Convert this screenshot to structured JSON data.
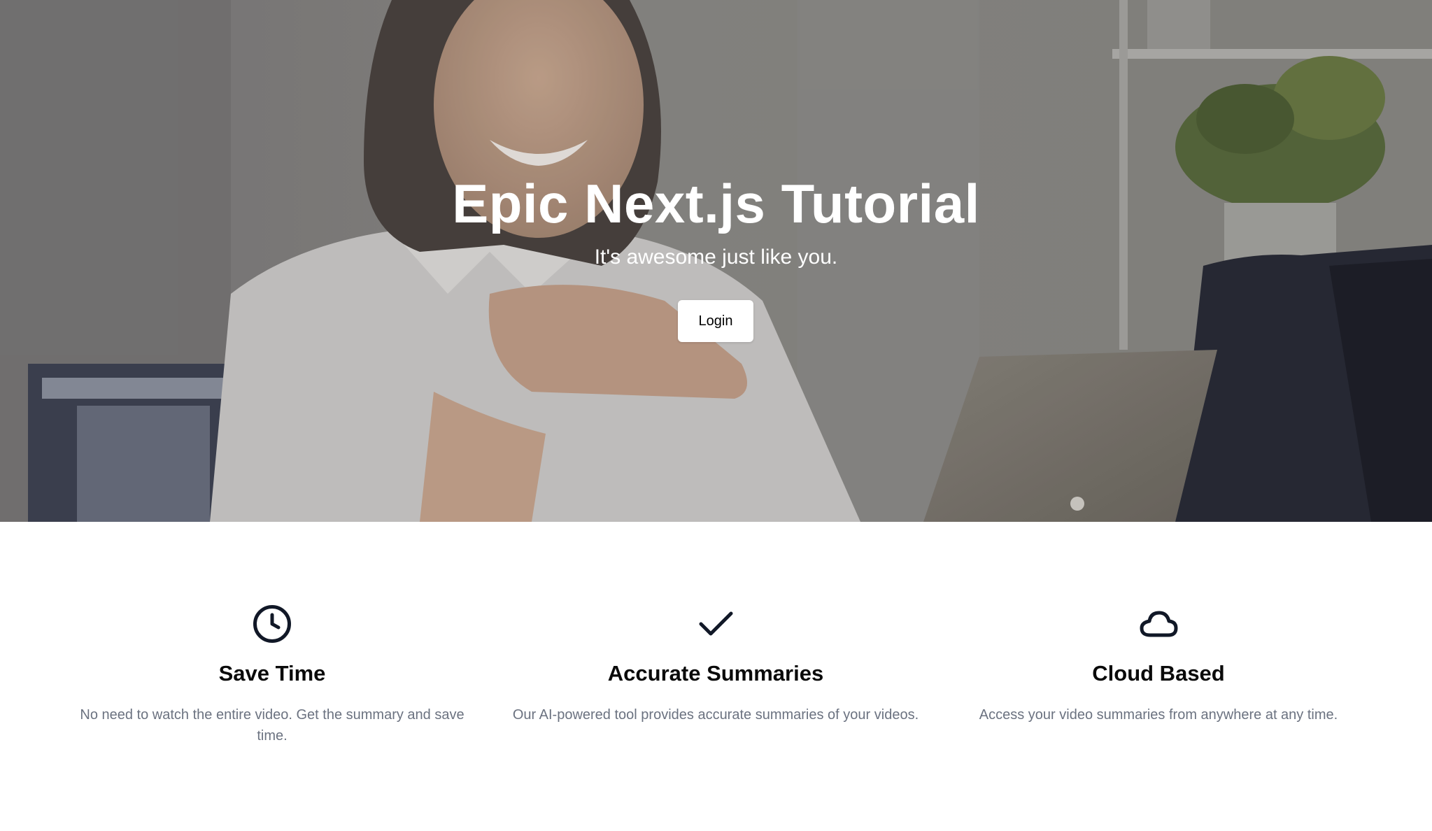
{
  "hero": {
    "title": "Epic Next.js Tutorial",
    "subtitle": "It's awesome just like you.",
    "login_label": "Login",
    "image_alt": "Smiling woman sitting at a desk with a laptop"
  },
  "features": [
    {
      "icon": "clock-icon",
      "title": "Save Time",
      "text": "No need to watch the entire video. Get the summary and save time."
    },
    {
      "icon": "check-icon",
      "title": "Accurate Summaries",
      "text": "Our AI-powered tool provides accurate summaries of your videos."
    },
    {
      "icon": "cloud-icon",
      "title": "Cloud Based",
      "text": "Access your video summaries from anywhere at any time."
    }
  ],
  "colors": {
    "hero_text": "#ffffff",
    "button_bg": "#ffffff",
    "heading": "#0a0a0a",
    "body_text": "#6b7280",
    "icon_stroke": "#111827"
  }
}
